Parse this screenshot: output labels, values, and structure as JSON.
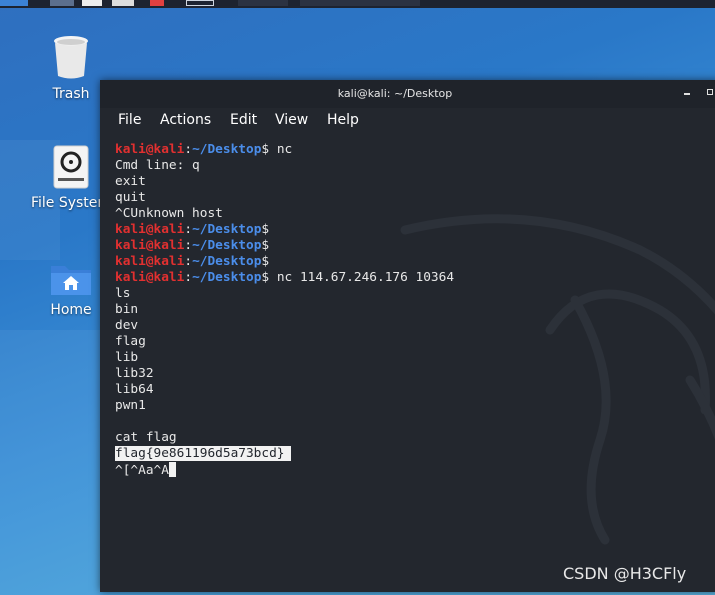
{
  "window": {
    "title": "kali@kali: ~/Desktop"
  },
  "menu": [
    "File",
    "Actions",
    "Edit",
    "View",
    "Help"
  ],
  "desktop_icons": [
    {
      "label": "Trash",
      "icon": "trash-icon"
    },
    {
      "label": "File System",
      "icon": "drive-icon"
    },
    {
      "label": "Home",
      "icon": "home-folder-icon"
    }
  ],
  "terminal": {
    "prompt": {
      "user": "kali@kali",
      "colon": ":",
      "path": "~/Desktop",
      "dollar": "$"
    },
    "lines": [
      {
        "type": "prompt",
        "cmd": " nc"
      },
      {
        "type": "out",
        "text": "Cmd line: q"
      },
      {
        "type": "out",
        "text": "exit"
      },
      {
        "type": "out",
        "text": "quit"
      },
      {
        "type": "out",
        "text": "^CUnknown host"
      },
      {
        "type": "prompt",
        "cmd": ""
      },
      {
        "type": "prompt",
        "cmd": ""
      },
      {
        "type": "prompt",
        "cmd": ""
      },
      {
        "type": "prompt",
        "cmd": " nc 114.67.246.176 10364"
      },
      {
        "type": "out",
        "text": "ls"
      },
      {
        "type": "out",
        "text": "bin"
      },
      {
        "type": "out",
        "text": "dev"
      },
      {
        "type": "out",
        "text": "flag"
      },
      {
        "type": "out",
        "text": "lib"
      },
      {
        "type": "out",
        "text": "lib32"
      },
      {
        "type": "out",
        "text": "lib64"
      },
      {
        "type": "out",
        "text": "pwn1"
      },
      {
        "type": "out",
        "text": ""
      },
      {
        "type": "out",
        "text": "cat flag"
      },
      {
        "type": "selected",
        "text": "flag{9e861196d5a73bcd}"
      },
      {
        "type": "cursor",
        "text": "^[^Aa^A"
      }
    ]
  },
  "watermark": "CSDN @H3CFly",
  "colors": {
    "prompt_user": "#e23030",
    "prompt_path": "#4b8eeb",
    "terminal_bg": "#23272e",
    "desktop_bg": "#2a78c8"
  }
}
